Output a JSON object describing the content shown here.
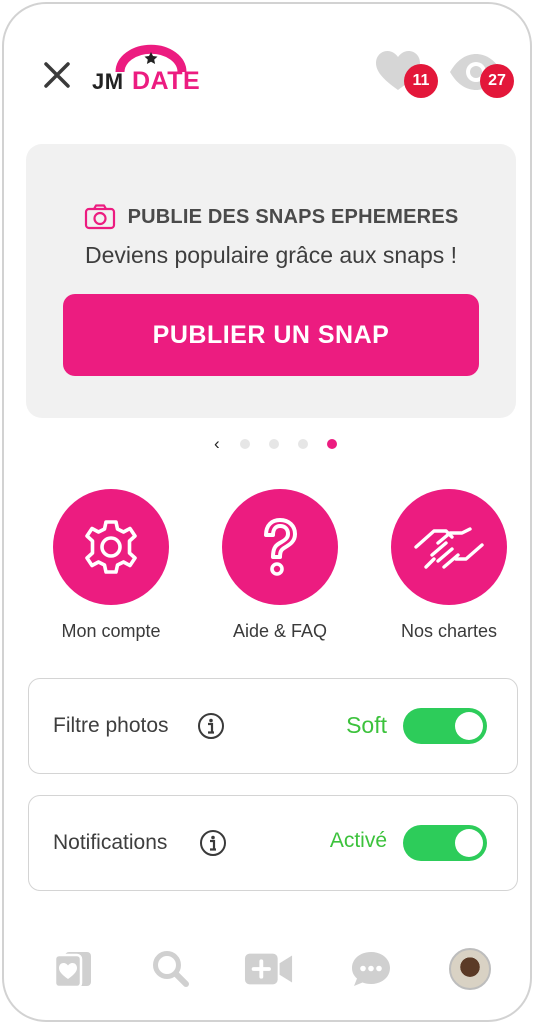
{
  "header": {
    "logo": {
      "part1": "JM",
      "part2": "DATE"
    },
    "likes_count": "11",
    "views_count": "27"
  },
  "promo": {
    "title": "PUBLIE DES SNAPS EPHEMERES",
    "subtitle": "Deviens populaire grâce aux snaps !",
    "button_label": "PUBLIER UN SNAP",
    "pager": {
      "total": 4,
      "active_index": 3
    }
  },
  "menu": {
    "items": [
      {
        "label": "Mon compte",
        "icon": "gear-icon"
      },
      {
        "label": "Aide & FAQ",
        "icon": "question-icon"
      },
      {
        "label": "Nos chartes",
        "icon": "handshake-icon"
      }
    ]
  },
  "settings": {
    "photo_filter": {
      "label": "Filtre photos",
      "value": "Soft",
      "enabled": true
    },
    "notifications": {
      "label": "Notifications",
      "value": "Activé",
      "enabled": true
    }
  },
  "bottom_nav": {
    "items": [
      "cards-icon",
      "search-icon",
      "video-plus-icon",
      "chat-icon",
      "avatar"
    ]
  },
  "colors": {
    "brand_pink": "#ec1c80",
    "badge_red": "#e3173a",
    "toggle_green": "#2dcc5a",
    "state_green": "#3cc23c",
    "nav_gray": "#d0d0d0"
  }
}
